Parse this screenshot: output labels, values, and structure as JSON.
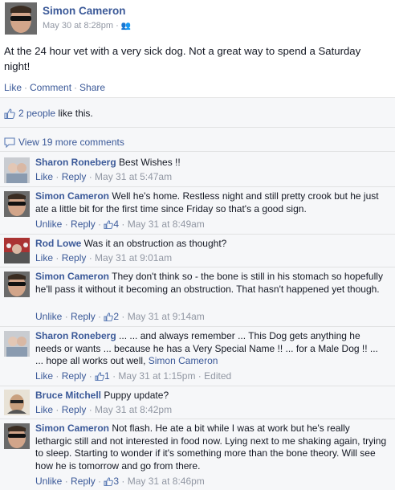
{
  "post": {
    "author": "Simon Cameron",
    "timestamp": "May 30 at 8:28pm",
    "text": "At the 24 hour vet with a very sick dog. Not a great way to spend a Saturday night!",
    "actions": [
      "Like",
      "Comment",
      "Share"
    ]
  },
  "likes": {
    "count_text": "2 people",
    "suffix": "like this."
  },
  "view_more": "View 19 more comments",
  "comments": [
    {
      "author": "Sharon Roneberg",
      "text": "Best Wishes !!",
      "like": "Like",
      "reply": "Reply",
      "likes": "",
      "time": "May 31 at 5:47am",
      "edited": ""
    },
    {
      "author": "Simon Cameron",
      "text": "Well he's home. Restless night and still pretty crook but he just ate a little bit for the first time since Friday so that's a good sign.",
      "like": "Unlike",
      "reply": "Reply",
      "likes": "4",
      "time": "May 31 at 8:49am",
      "edited": ""
    },
    {
      "author": "Rod Lowe",
      "text": "Was it an obstruction as thought?",
      "like": "Like",
      "reply": "Reply",
      "likes": "",
      "time": "May 31 at 9:01am",
      "edited": ""
    },
    {
      "author": "Simon Cameron",
      "text": "They don't think so - the bone is still in his stomach so hopefully he'll pass it without it becoming an obstruction. That hasn't happened yet though.",
      "like": "Unlike",
      "reply": "Reply",
      "likes": "2",
      "time": "May 31 at 9:14am",
      "edited": ""
    },
    {
      "author": "Sharon Roneberg",
      "text": "... ... and always remember ... This Dog gets anything he needs or wants ... because he has a Very Special Name !! ... for a Male Dog !! ... ... hope all works out well,",
      "mention": "Simon Cameron",
      "like": "Like",
      "reply": "Reply",
      "likes": "1",
      "time": "May 31 at 1:15pm",
      "edited": "Edited"
    },
    {
      "author": "Bruce Mitchell",
      "text": "Puppy update?",
      "like": "Like",
      "reply": "Reply",
      "likes": "",
      "time": "May 31 at 8:42pm",
      "edited": ""
    },
    {
      "author": "Simon Cameron",
      "text": "Not flash. He ate a bit while I was at work but he's really lethargic still and not interested in food now. Lying next to me shaking again, trying to sleep. Starting to wonder if it's something more than the bone theory. Will see how he is tomorrow and go from there.",
      "like": "Unlike",
      "reply": "Reply",
      "likes": "3",
      "time": "May 31 at 8:46pm",
      "edited": ""
    }
  ],
  "icons": {
    "like": "thumbs-up-icon",
    "comment": "comment-bubble-icon",
    "audience": "friends-audience-icon"
  },
  "colors": {
    "link": "#3b5998",
    "meta": "#9197a3",
    "ufi_bg": "#f6f7f9"
  }
}
